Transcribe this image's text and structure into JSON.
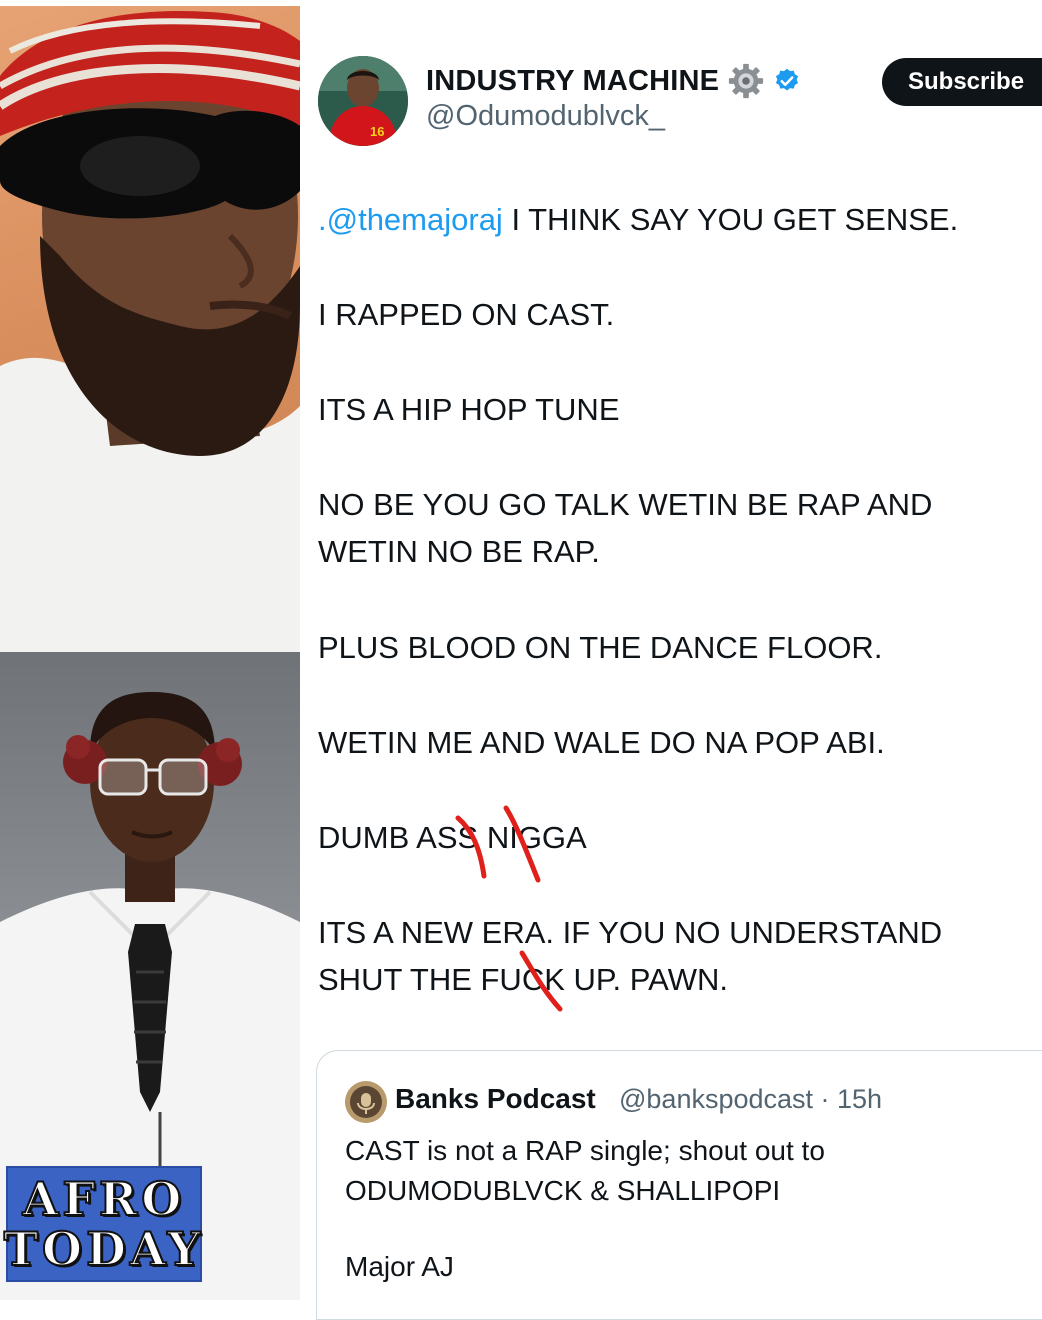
{
  "tweet": {
    "display_name": "INDUSTRY MACHINE",
    "handle": "@Odumodublvck_",
    "subscribe_label": "Subscribe",
    "icons": {
      "name_badge": "gear-icon",
      "verified": "verified-badge-icon"
    },
    "lines": {
      "l1_mention": ".@themajoraj",
      "l1_rest": " I THINK SAY YOU GET SENSE.",
      "l2": "I RAPPED ON CAST.",
      "l3": "ITS A HIP HOP TUNE",
      "l4a": "NO BE YOU GO TALK WETIN BE RAP AND",
      "l4b": "WETIN NO BE RAP.",
      "l5": "PLUS BLOOD ON THE DANCE FLOOR.",
      "l6": "WETIN ME AND WALE DO NA POP ABI.",
      "l7": "DUMB ASS NIGGA",
      "l8a": "ITS A NEW ERA. IF YOU NO UNDERSTAND",
      "l8b": "SHUT THE FUCK UP. PAWN."
    }
  },
  "quote": {
    "name": "Banks Podcast",
    "handle_time": "@bankspodcast · 15h",
    "text_line1": "CAST is not a RAP single; shout out to",
    "text_line2": "ODUMODUBLVCK & SHALLIPOPI",
    "signature": "Major AJ"
  },
  "watermark": {
    "line1": "AFRO",
    "line2": "TODAY"
  },
  "colors": {
    "mention": "#1d9bf0",
    "text": "#0f1419",
    "secondary": "#536471",
    "censor_mark": "#e0201b",
    "subscribe_bg": "#0f1419",
    "verified": "#1d9bf0"
  }
}
